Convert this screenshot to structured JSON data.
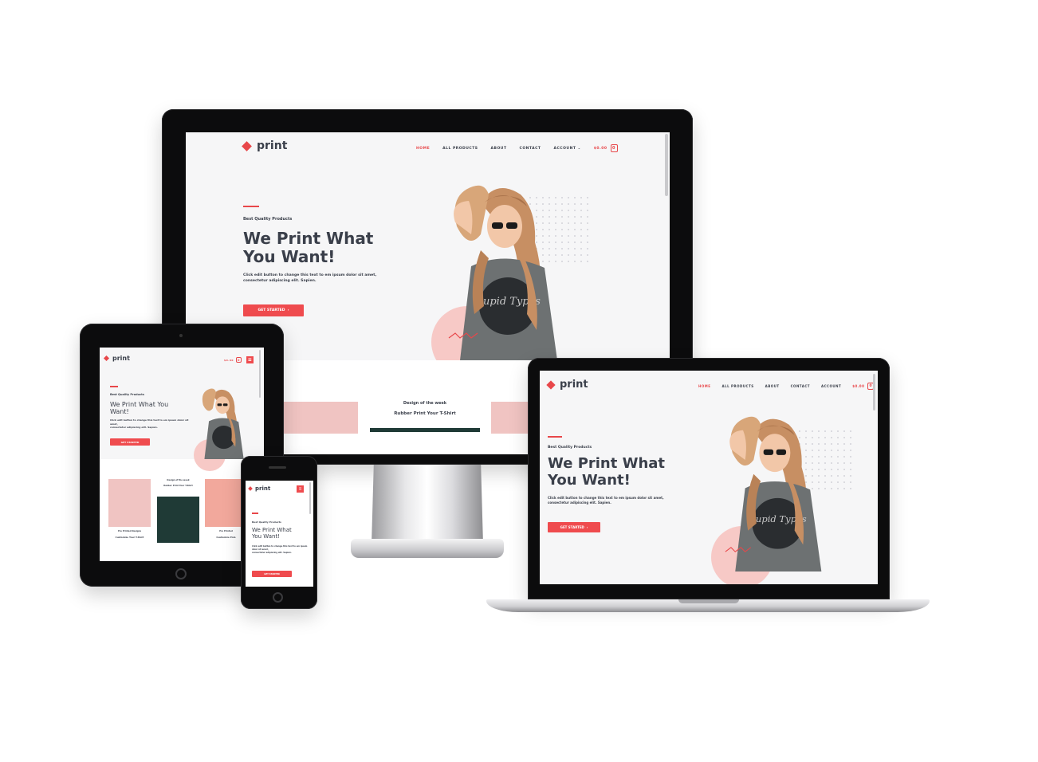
{
  "brand": {
    "name": "print",
    "accent": "#e8474a"
  },
  "nav": {
    "home": "HOME",
    "all_products": "ALL PRODUCTS",
    "about": "ABOUT",
    "contact": "CONTACT",
    "account": "ACCOUNT",
    "cart_price": "$0.00",
    "cart_count": "0"
  },
  "hero": {
    "kicker": "Best Quality Products",
    "headline_line1": "We Print What",
    "headline_line2": "You Want!",
    "headline_tablet": "We Print What You Want!",
    "description_line1": "Click edit button to change this text to em ipsum dolor sit amet,",
    "description_line2": "consectetur adipiscing elit. Sapien.",
    "cta": "GET STARTED"
  },
  "shirt_text": "Cupid Types",
  "week": {
    "title": "Design of the week",
    "subtitle": "Rubber Print Your T-Shirt"
  },
  "products": {
    "item1": "Customize Your T-Shirt",
    "item2": "Customize Polo",
    "item1_kicker": "Pre Printed Designs",
    "item2_kicker": "Pre Printed"
  },
  "icons": [
    "heart-logo-icon",
    "chevron-down-icon",
    "cart-icon",
    "arrow-right-icon",
    "menu-icon"
  ]
}
